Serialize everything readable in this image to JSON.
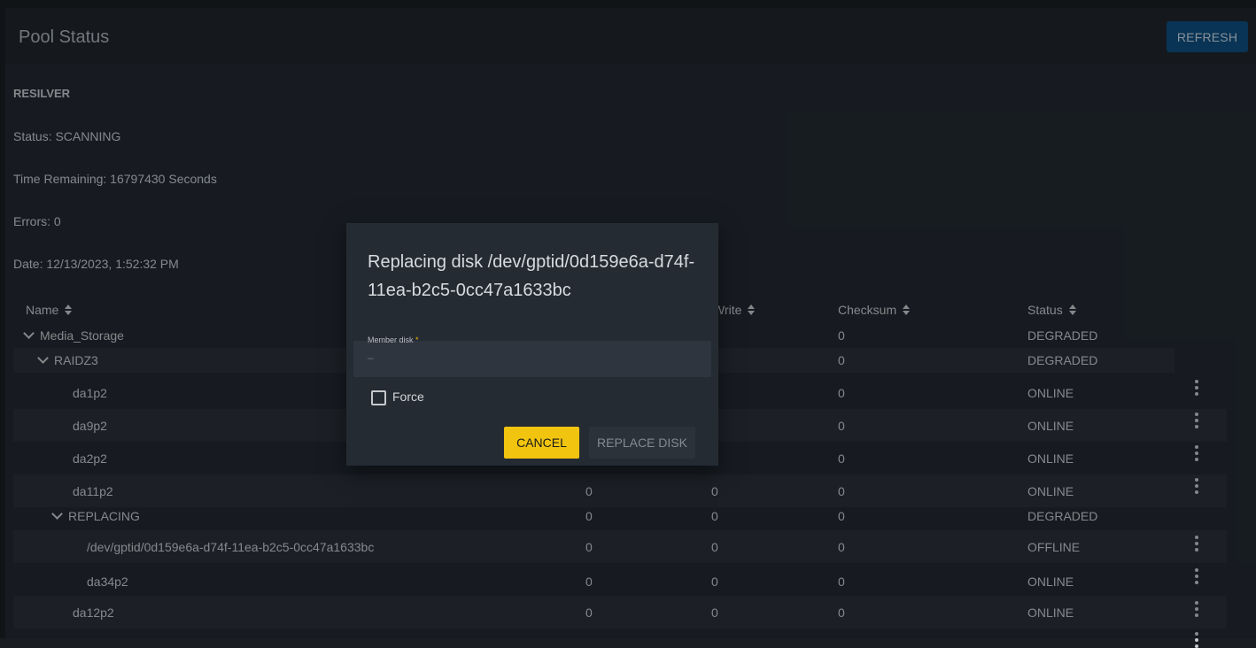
{
  "header": {
    "title": "Pool Status",
    "refresh_label": "REFRESH"
  },
  "resilver": {
    "heading": "RESILVER",
    "status": "Status: SCANNING",
    "time_remaining": "Time Remaining: 16797430 Seconds",
    "errors": "Errors: 0",
    "date": "Date: 12/13/2023, 1:52:32 PM"
  },
  "table": {
    "columns": {
      "name": "Name",
      "write": "Write",
      "checksum": "Checksum",
      "status": "Status"
    },
    "rows": [
      {
        "name": "Media_Storage",
        "read": "",
        "write": "",
        "checksum": "0",
        "status": "DEGRADED"
      },
      {
        "name": "RAIDZ3",
        "read": "",
        "write": "",
        "checksum": "0",
        "status": "DEGRADED"
      },
      {
        "name": "da1p2",
        "read": "",
        "write": "",
        "checksum": "0",
        "status": "ONLINE"
      },
      {
        "name": "da9p2",
        "read": "",
        "write": "",
        "checksum": "0",
        "status": "ONLINE"
      },
      {
        "name": "da2p2",
        "read": "",
        "write": "",
        "checksum": "0",
        "status": "ONLINE"
      },
      {
        "name": "da11p2",
        "read": "0",
        "write": "0",
        "checksum": "0",
        "status": "ONLINE"
      },
      {
        "name": "REPLACING",
        "read": "0",
        "write": "0",
        "checksum": "0",
        "status": "DEGRADED"
      },
      {
        "name": "/dev/gptid/0d159e6a-d74f-11ea-b2c5-0cc47a1633bc",
        "read": "0",
        "write": "0",
        "checksum": "0",
        "status": "OFFLINE"
      },
      {
        "name": "da34p2",
        "read": "0",
        "write": "0",
        "checksum": "0",
        "status": "ONLINE"
      },
      {
        "name": "da12p2",
        "read": "0",
        "write": "0",
        "checksum": "0",
        "status": "ONLINE"
      }
    ]
  },
  "dialog": {
    "title": "Replacing disk /dev/gptid/0d159e6a-d74f-11ea-b2c5-0cc47a1633bc",
    "field_label": "Member disk",
    "required_mark": "*",
    "field_value": "–",
    "force_label": "Force",
    "cancel_label": "CANCEL",
    "replace_label": "REPLACE DISK"
  },
  "colors": {
    "accent": "#f1c40f",
    "primary": "#0e4d7e"
  }
}
